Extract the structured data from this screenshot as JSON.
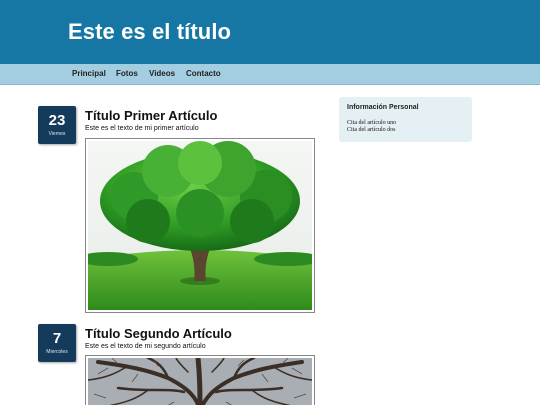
{
  "header": {
    "title": "Este es el título"
  },
  "nav": {
    "items": [
      "Principal",
      "Fotos",
      "Videos",
      "Contacto"
    ]
  },
  "articles": [
    {
      "day": "23",
      "weekday": "Viernes",
      "title": "Título Primer Artículo",
      "text": "Este es el texto de mi primer artículo",
      "image": "oak-tree-image"
    },
    {
      "day": "7",
      "weekday": "Miercoles",
      "title": "Título Segundo Artículo",
      "text": "Este es el texto de mi segundo artículo",
      "image": "bare-tree-branches-image"
    }
  ],
  "sidebar": {
    "heading": "Información Personal",
    "links": [
      "Cita del artículo uno",
      "Cita del artículo dos"
    ]
  },
  "colors": {
    "header": "#1777a4",
    "nav": "#a3cde0",
    "date_badge": "#143b5c",
    "sidebar": "#e5f0f4"
  }
}
